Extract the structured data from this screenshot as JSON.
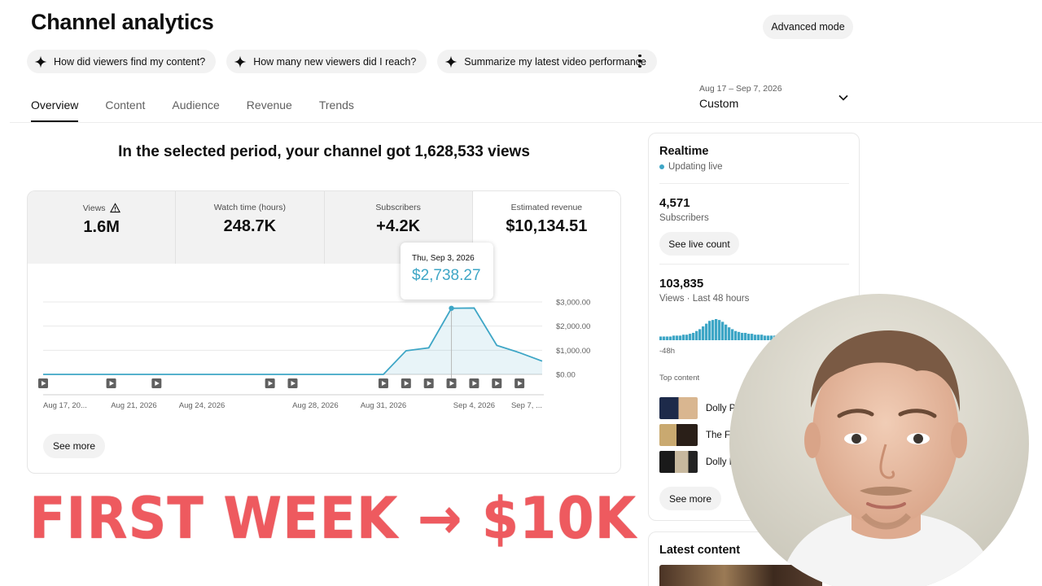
{
  "page": {
    "title": "Channel analytics",
    "advanced_mode": "Advanced mode"
  },
  "chips": [
    {
      "icon": "sparkle-icon",
      "label": "How did viewers find my content?"
    },
    {
      "icon": "sparkle-icon",
      "label": "How many new viewers did I reach?"
    },
    {
      "icon": "sparkle-icon",
      "label": "Summarize my latest video performance"
    }
  ],
  "tabs": [
    "Overview",
    "Content",
    "Audience",
    "Revenue",
    "Trends"
  ],
  "active_tab": "Overview",
  "date_range": {
    "range": "Aug 17 – Sep 7, 2026",
    "label": "Custom"
  },
  "summary": "In the selected period, your channel got 1,628,533 views",
  "metrics": [
    {
      "label": "Views",
      "value": "1.6M",
      "warning": true
    },
    {
      "label": "Watch time (hours)",
      "value": "248.7K"
    },
    {
      "label": "Subscribers",
      "value": "+4.2K"
    },
    {
      "label": "Estimated revenue",
      "value": "$10,134.51",
      "selected": true
    }
  ],
  "tooltip": {
    "date": "Thu, Sep 3, 2026",
    "value": "$2,738.27"
  },
  "see_more": "See more",
  "chart_data": {
    "type": "area",
    "series": [
      {
        "values": [
          0,
          0,
          0,
          0,
          0,
          0,
          0,
          0,
          0,
          0,
          0,
          0,
          0,
          0,
          0,
          0,
          980,
          1100,
          2738.27,
          2750,
          1200,
          900,
          550
        ]
      }
    ],
    "x_tick_labels": [
      "Aug 17, 20...",
      "Aug 21, 2026",
      "Aug 24, 2026",
      "Aug 28, 2026",
      "Aug 31, 2026",
      "Sep 4, 2026",
      "Sep 7, ..."
    ],
    "y_tick_labels": [
      "$3,000.00",
      "$2,000.00",
      "$1,000.00",
      "$0.00"
    ],
    "ylim": [
      0,
      3000
    ],
    "video_marker_indices": [
      0,
      3,
      5,
      10,
      11,
      15,
      16,
      17,
      18,
      19,
      20,
      21
    ],
    "highlight_index": 18,
    "color": "#3ea6c6"
  },
  "realtime": {
    "title": "Realtime",
    "status": "Updating live",
    "subscribers_value": "4,571",
    "subscribers_label": "Subscribers",
    "live_count_button": "See live count",
    "views_value": "103,835",
    "views_label": "Views · Last 48 hours",
    "axis_start": "-48h",
    "bars": [
      4,
      4,
      4,
      4,
      5,
      5,
      5,
      6,
      6,
      7,
      8,
      10,
      12,
      15,
      18,
      21,
      22,
      23,
      22,
      20,
      17,
      14,
      12,
      10,
      9,
      8,
      8,
      7,
      7,
      6,
      6,
      6,
      5,
      5,
      5,
      5,
      4,
      4,
      4,
      4,
      4,
      4
    ],
    "top_content_label": "Top content",
    "top_content": [
      {
        "title": "Dolly P",
        "thumb": "thumbnail-1"
      },
      {
        "title": "The Fi",
        "thumb": "thumbnail-2"
      },
      {
        "title": "Dolly F",
        "thumb": "thumbnail-3"
      }
    ],
    "see_more": "See more"
  },
  "latest": {
    "title": "Latest content"
  },
  "overlay": {
    "headline": "FIRST WEEK → $10K"
  },
  "colors": {
    "accent": "#3ea6c6",
    "overlay_red": "#ee5a5f",
    "chip_bg": "#f2f2f2"
  }
}
